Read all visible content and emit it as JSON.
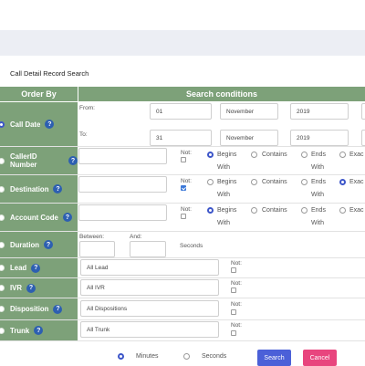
{
  "page": {
    "section_title": "Call Detail Record Search"
  },
  "header": {
    "order_by": "Order By",
    "search_conditions": "Search conditions"
  },
  "rows": {
    "call_date": {
      "label": "Call Date",
      "help": "?",
      "from_label": "From:",
      "to_label": "To:",
      "from_day": "01",
      "from_month": "November",
      "from_year": "2019",
      "to_day": "31",
      "to_month": "November",
      "to_year": "2019"
    },
    "callerid": {
      "label": "CallerID Number",
      "help": "?",
      "not_label": "Not:"
    },
    "destination": {
      "label": "Destination",
      "help": "?",
      "not_label": "Not:"
    },
    "account_code": {
      "label": "Account Code",
      "help": "?",
      "not_label": "Not:"
    },
    "duration": {
      "label": "Duration",
      "help": "?",
      "between_label": "Between:",
      "and_label": "And:",
      "unit": "Seconds"
    },
    "lead": {
      "label": "Lead",
      "help": "?",
      "value": "All Lead",
      "not_label": "Not:"
    },
    "ivr": {
      "label": "IVR",
      "help": "?",
      "value": "All IVR",
      "not_label": "Not:"
    },
    "disposition": {
      "label": "Disposition",
      "help": "?",
      "value": "All Dispositions",
      "not_label": "Not:"
    },
    "trunk": {
      "label": "Trunk",
      "help": "?",
      "value": "All Trunk",
      "not_label": "Not:"
    }
  },
  "match_options": {
    "begins": "Begins",
    "with": "With",
    "contains": "Contains",
    "ends": "Ends",
    "ends_with": "With",
    "exact": "Exac"
  },
  "selected": {
    "order_by": "Call Date",
    "callerid_match": "Begins With",
    "destination_match": "Exact",
    "account_code_match": "Begins With",
    "destination_not_checked": true,
    "unit": "Minutes"
  },
  "footer": {
    "minutes": "Minutes",
    "seconds": "Seconds",
    "search": "Search",
    "cancel": "Cancel"
  },
  "colors": {
    "header_green": "#7da179",
    "search_blue": "#4b60d8",
    "cancel_pink": "#e8457e",
    "radio_blue": "#3d56c9"
  }
}
